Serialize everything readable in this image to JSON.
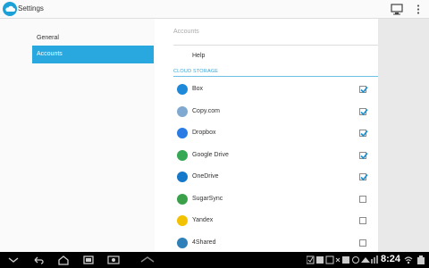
{
  "app": {
    "title": "Settings"
  },
  "left_nav": {
    "items": [
      {
        "label": "General"
      },
      {
        "label": "Accounts"
      }
    ]
  },
  "right": {
    "header": "Accounts",
    "help_label": "Help",
    "section_label": "CLOUD STORAGE"
  },
  "services": [
    {
      "name": "Box",
      "icon": "box-logo-icon",
      "color": "#1e88d9",
      "checked": true
    },
    {
      "name": "Copy.com",
      "icon": "copy-logo-icon",
      "color": "#7fa9d1",
      "checked": true
    },
    {
      "name": "Dropbox",
      "icon": "dropbox-logo-icon",
      "color": "#2b7be4",
      "checked": true
    },
    {
      "name": "Google Drive",
      "icon": "google-drive-logo-icon",
      "color": "#34a853",
      "checked": true
    },
    {
      "name": "OneDrive",
      "icon": "onedrive-logo-icon",
      "color": "#1678c8",
      "checked": true
    },
    {
      "name": "SugarSync",
      "icon": "sugarsync-logo-icon",
      "color": "#3aa14a",
      "checked": false
    },
    {
      "name": "Yandex",
      "icon": "yandex-logo-icon",
      "color": "#f2c200",
      "checked": false
    },
    {
      "name": "4Shared",
      "icon": "4shared-logo-icon",
      "color": "#2f80b8",
      "checked": false
    }
  ],
  "status_bar": {
    "time": "8:24"
  },
  "colors": {
    "accent": "#29a7df",
    "section": "#3aa3d6"
  }
}
